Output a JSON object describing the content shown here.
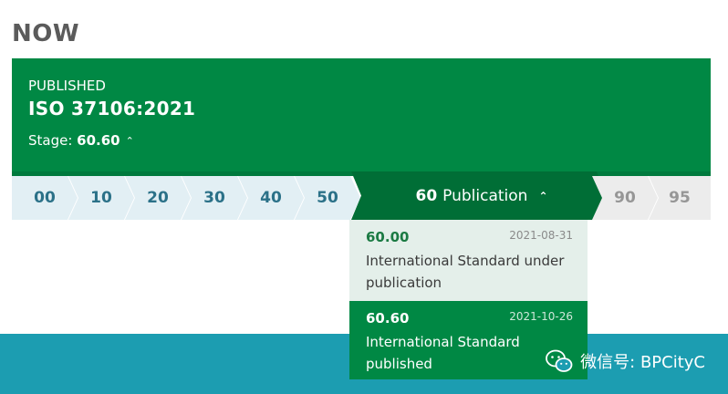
{
  "now_heading": "NOW",
  "status": {
    "label": "PUBLISHED",
    "title": "ISO 37106:2021",
    "stage_prefix": "Stage: ",
    "stage_value": "60.60",
    "chevron": "^"
  },
  "stages": [
    {
      "code": "00",
      "state": "past"
    },
    {
      "code": "10",
      "state": "past"
    },
    {
      "code": "20",
      "state": "past"
    },
    {
      "code": "30",
      "state": "past"
    },
    {
      "code": "40",
      "state": "past"
    },
    {
      "code": "50",
      "state": "past"
    },
    {
      "code": "60",
      "name": "Publication",
      "state": "current"
    },
    {
      "code": "90",
      "state": "future"
    },
    {
      "code": "95",
      "state": "future"
    }
  ],
  "active_stage": {
    "code": "60",
    "name": "Publication"
  },
  "stage_90": "90",
  "stage_95": "95",
  "substages": [
    {
      "code": "60.00",
      "date": "2021-08-31",
      "description": "International Standard under publication"
    },
    {
      "code": "60.60",
      "date": "2021-10-26",
      "description": "International Standard published"
    }
  ],
  "watermark": {
    "text": "微信号: BPCityC",
    "icon": "wechat-icon"
  },
  "colors": {
    "green": "#008844",
    "dark_green": "#006e36",
    "past_stage_bg": "#e2eff4",
    "past_stage_text": "#2b7188",
    "future_stage_bg": "#ececec",
    "future_stage_text": "#969696",
    "band": "#1c9db1"
  }
}
